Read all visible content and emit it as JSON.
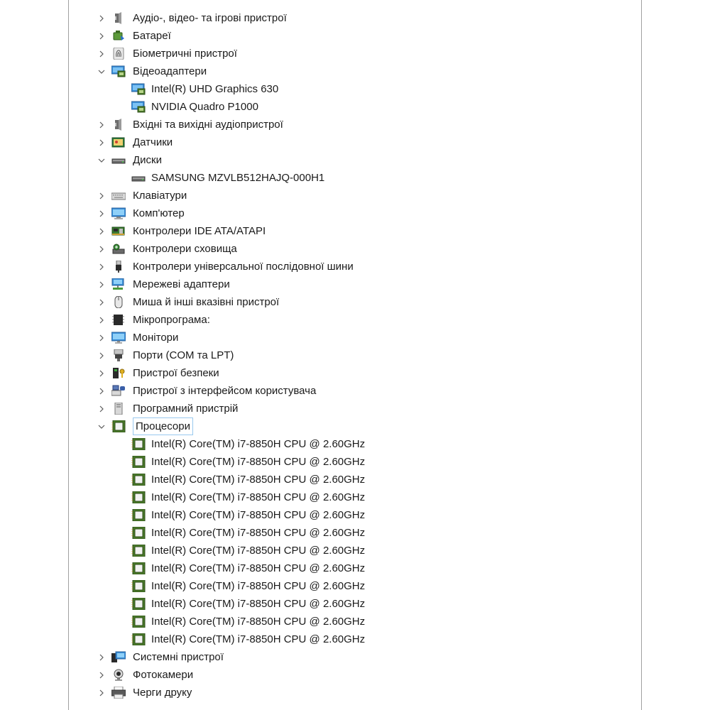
{
  "tree": [
    {
      "label": "Аудіо-, відео- та ігрові пристрої",
      "icon": "speaker-icon",
      "level": 0,
      "expanded": false
    },
    {
      "label": "Батареї",
      "icon": "battery-icon",
      "level": 0,
      "expanded": false
    },
    {
      "label": "Біометричні пристрої",
      "icon": "fingerprint-icon",
      "level": 0,
      "expanded": false
    },
    {
      "label": "Відеоадаптери",
      "icon": "display-adapter-icon",
      "level": 0,
      "expanded": true
    },
    {
      "label": "Intel(R) UHD Graphics 630",
      "icon": "display-adapter-icon",
      "level": 1
    },
    {
      "label": "NVIDIA Quadro P1000",
      "icon": "display-adapter-icon",
      "level": 1
    },
    {
      "label": "Вхідні та вихідні аудіопристрої",
      "icon": "speaker-icon",
      "level": 0,
      "expanded": false
    },
    {
      "label": "Датчики",
      "icon": "sensor-icon",
      "level": 0,
      "expanded": false
    },
    {
      "label": "Диски",
      "icon": "disk-drive-icon",
      "level": 0,
      "expanded": true
    },
    {
      "label": "SAMSUNG MZVLB512HAJQ-000H1",
      "icon": "disk-drive-icon",
      "level": 1
    },
    {
      "label": "Клавіатури",
      "icon": "keyboard-icon",
      "level": 0,
      "expanded": false
    },
    {
      "label": "Комп'ютер",
      "icon": "computer-icon",
      "level": 0,
      "expanded": false
    },
    {
      "label": "Контролери IDE ATA/ATAPI",
      "icon": "ide-controller-icon",
      "level": 0,
      "expanded": false
    },
    {
      "label": "Контролери сховища",
      "icon": "storage-controller-icon",
      "level": 0,
      "expanded": false
    },
    {
      "label": "Контролери універсальної послідовної шини",
      "icon": "usb-icon",
      "level": 0,
      "expanded": false
    },
    {
      "label": "Мережеві адаптери",
      "icon": "network-adapter-icon",
      "level": 0,
      "expanded": false
    },
    {
      "label": "Миша й інші вказівні пристрої",
      "icon": "mouse-icon",
      "level": 0,
      "expanded": false
    },
    {
      "label": "Мікропрограма:",
      "icon": "firmware-icon",
      "level": 0,
      "expanded": false
    },
    {
      "label": "Монітори",
      "icon": "monitor-icon",
      "level": 0,
      "expanded": false
    },
    {
      "label": "Порти (COM та LPT)",
      "icon": "port-icon",
      "level": 0,
      "expanded": false
    },
    {
      "label": "Пристрої безпеки",
      "icon": "security-device-icon",
      "level": 0,
      "expanded": false
    },
    {
      "label": "Пристрої з інтерфейсом користувача",
      "icon": "hid-icon",
      "level": 0,
      "expanded": false
    },
    {
      "label": "Програмний пристрій",
      "icon": "software-device-icon",
      "level": 0,
      "expanded": false
    },
    {
      "label": "Процесори",
      "icon": "processor-icon",
      "level": 0,
      "expanded": true,
      "selected": true
    },
    {
      "label": "Intel(R) Core(TM) i7-8850H CPU @ 2.60GHz",
      "icon": "processor-icon",
      "level": 1
    },
    {
      "label": "Intel(R) Core(TM) i7-8850H CPU @ 2.60GHz",
      "icon": "processor-icon",
      "level": 1
    },
    {
      "label": "Intel(R) Core(TM) i7-8850H CPU @ 2.60GHz",
      "icon": "processor-icon",
      "level": 1
    },
    {
      "label": "Intel(R) Core(TM) i7-8850H CPU @ 2.60GHz",
      "icon": "processor-icon",
      "level": 1
    },
    {
      "label": "Intel(R) Core(TM) i7-8850H CPU @ 2.60GHz",
      "icon": "processor-icon",
      "level": 1
    },
    {
      "label": "Intel(R) Core(TM) i7-8850H CPU @ 2.60GHz",
      "icon": "processor-icon",
      "level": 1
    },
    {
      "label": "Intel(R) Core(TM) i7-8850H CPU @ 2.60GHz",
      "icon": "processor-icon",
      "level": 1
    },
    {
      "label": "Intel(R) Core(TM) i7-8850H CPU @ 2.60GHz",
      "icon": "processor-icon",
      "level": 1
    },
    {
      "label": "Intel(R) Core(TM) i7-8850H CPU @ 2.60GHz",
      "icon": "processor-icon",
      "level": 1
    },
    {
      "label": "Intel(R) Core(TM) i7-8850H CPU @ 2.60GHz",
      "icon": "processor-icon",
      "level": 1
    },
    {
      "label": "Intel(R) Core(TM) i7-8850H CPU @ 2.60GHz",
      "icon": "processor-icon",
      "level": 1
    },
    {
      "label": "Intel(R) Core(TM) i7-8850H CPU @ 2.60GHz",
      "icon": "processor-icon",
      "level": 1
    },
    {
      "label": "Системні пристрої",
      "icon": "system-device-icon",
      "level": 0,
      "expanded": false
    },
    {
      "label": "Фотокамери",
      "icon": "camera-icon",
      "level": 0,
      "expanded": false
    },
    {
      "label": "Черги друку",
      "icon": "printer-icon",
      "level": 0,
      "expanded": false
    }
  ],
  "colors": {
    "selection_border": "#99c9ef",
    "chip_green": "#4a7a2a",
    "monitor_blue": "#3a8fd8"
  }
}
